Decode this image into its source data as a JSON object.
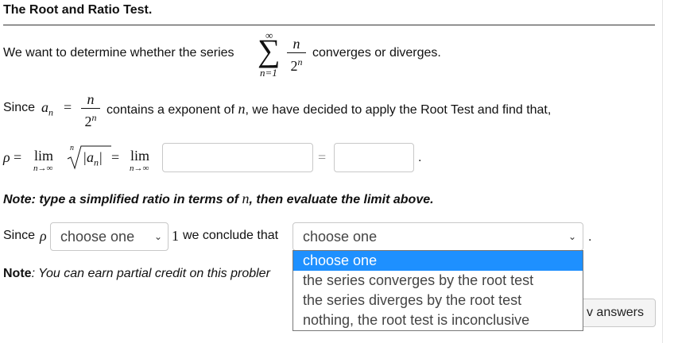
{
  "title": "The Root and Ratio Test.",
  "intro": {
    "before": "We want to determine whether the series",
    "after": "converges or diverges.",
    "sum_top": "∞",
    "sum_bottom": "n=1",
    "numerator": "n",
    "denominator_base": "2",
    "denominator_exp": "n"
  },
  "since_line": {
    "since": "Since",
    "a_n": "a",
    "a_n_sub": "n",
    "equals": "=",
    "numerator": "n",
    "denominator_base": "2",
    "denominator_exp": "n",
    "text": "contains a exponent of",
    "var": "n",
    "rest": ", we have decided to apply the Root Test and find that,"
  },
  "limit_line": {
    "rho": "ρ",
    "eq1": "=",
    "lim1": "lim",
    "lim1_sub": "n→∞",
    "root_index": "n",
    "abs_expr": "|a",
    "abs_sub": "n",
    "abs_close": "|",
    "eq2": "=",
    "lim2": "lim",
    "lim2_sub": "n→∞",
    "eq3": "=",
    "period": ".",
    "input1_value": "",
    "input2_value": ""
  },
  "note1": {
    "prefix": "Note: type a simplified ratio in terms of",
    "var": "n",
    "suffix": ", then evaluate the limit above."
  },
  "conclusion": {
    "since": "Since",
    "rho": "ρ",
    "select1_value": "choose one",
    "one": "1",
    "we_conclude": "we conclude that",
    "select2_value": "choose one",
    "period": "."
  },
  "note2": {
    "label": "Note",
    "text": ": You can earn partial credit on this probler"
  },
  "dropdown_options": [
    "choose one",
    "the series converges by the root test",
    "the series diverges by the root test",
    "nothing, the root test is inconclusive"
  ],
  "answers_button": "v answers",
  "colors": {
    "highlight": "#1e90ff"
  }
}
